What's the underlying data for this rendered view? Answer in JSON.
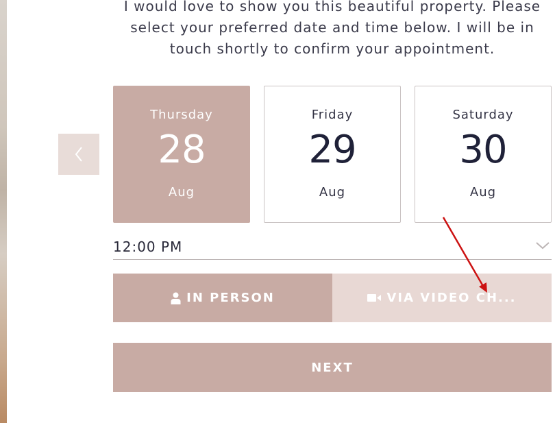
{
  "intro_lines": [
    "I would love to show you this beautiful property. Please",
    "select your preferred date and time below. I will be in",
    "touch shortly to confirm your appointment."
  ],
  "days": [
    {
      "weekday": "Thursday",
      "date": "28",
      "month": "Aug",
      "selected": true
    },
    {
      "weekday": "Friday",
      "date": "29",
      "month": "Aug",
      "selected": false
    },
    {
      "weekday": "Saturday",
      "date": "30",
      "month": "Aug",
      "selected": false
    }
  ],
  "time": {
    "value": "12:00 PM"
  },
  "modes": {
    "in_person": "IN PERSON",
    "video": "VIA VIDEO CH..."
  },
  "next_label": "NEXT",
  "colors": {
    "accent": "#c8aba4",
    "accent_light": "#e8d8d4",
    "annotation_arrow": "#cc1111"
  },
  "icons": {
    "prev": "chevron-left-icon",
    "time_dropdown": "chevron-down-icon",
    "in_person": "person-icon",
    "video": "video-camera-icon"
  }
}
